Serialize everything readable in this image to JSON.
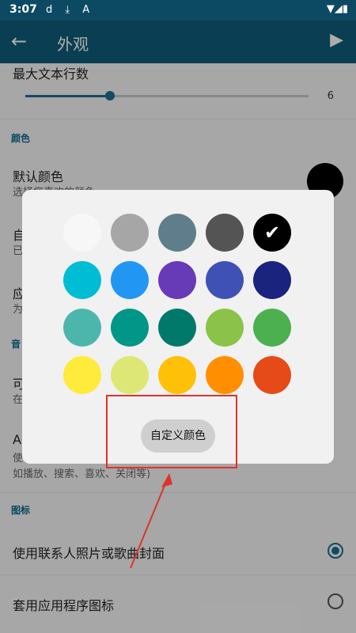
{
  "status_bar": {
    "time": "3:07",
    "left_icons": "d ⤓ A",
    "right_icons": "▼◢▮"
  },
  "app_bar": {
    "back_icon": "←",
    "title": "外观",
    "play_icon": "▶"
  },
  "settings": {
    "max_lines": {
      "title": "最大文本行数",
      "value": "6",
      "fraction": 0.3
    },
    "color_section": "颜色",
    "default_color": {
      "title": "默认颜色",
      "subtitle": "选择您喜欢的颜色",
      "swatch": "#000000"
    },
    "row_b": {
      "title": "自",
      "subtitle": "已"
    },
    "row_c": {
      "title": "应",
      "subtitle": "为"
    },
    "section_b": "音",
    "row_d": {
      "title": "可",
      "subtitle": "在"
    },
    "row_e": {
      "title": "A",
      "subtitle": "使",
      "subtitle2": "如播放、搜索、喜欢、关闭等)"
    },
    "icon_section": "图标",
    "use_contact_photo": {
      "title": "使用联系人照片或歌曲封面",
      "selected": true
    },
    "apply_app_icon": {
      "title": "套用应用程序图标",
      "selected": false
    }
  },
  "dialog": {
    "colors": [
      [
        "#f7f7f7",
        "#a6a6a6",
        "#607d8b",
        "#545454",
        "#000000"
      ],
      [
        "#00bcd4",
        "#2196f3",
        "#673ab7",
        "#3f51b5",
        "#1a237e"
      ],
      [
        "#4db6ac",
        "#009688",
        "#00796b",
        "#8bc34a",
        "#4caf50"
      ],
      [
        "#ffeb3b",
        "#dce775",
        "#ffc107",
        "#ff8f00",
        "#e64a19"
      ]
    ],
    "selected": "#000000",
    "check_icon": "✔",
    "custom_button": "自定义颜色"
  }
}
